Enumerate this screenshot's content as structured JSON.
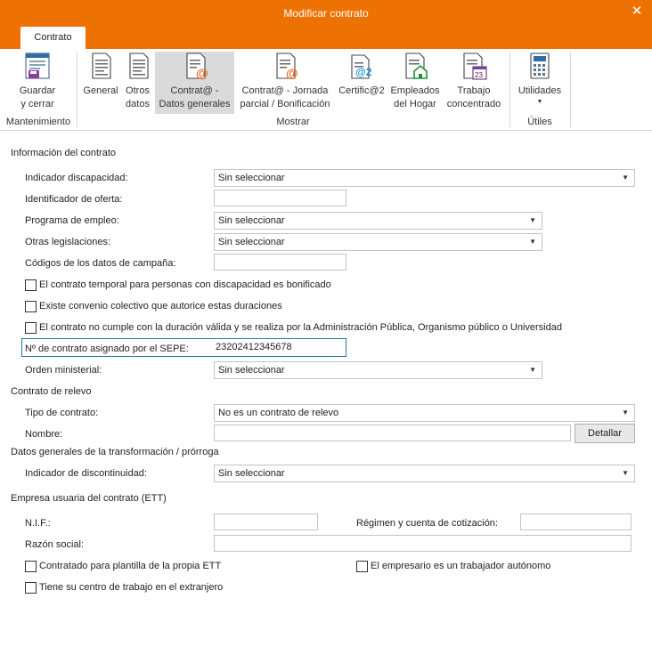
{
  "window": {
    "title": "Modificar contrato"
  },
  "tabs": [
    {
      "label": "Contrato"
    }
  ],
  "ribbon": {
    "mantenimiento": {
      "label": "Mantenimiento",
      "guardar": "Guardar\ny cerrar"
    },
    "mostrar": {
      "label": "Mostrar",
      "items": [
        {
          "label": "General"
        },
        {
          "label": "Otros\ndatos"
        },
        {
          "label": "Contrat@ -\nDatos generales"
        },
        {
          "label": "Contrat@ - Jornada\nparcial / Bonificación"
        },
        {
          "label": "Certific@2"
        },
        {
          "label": "Empleados\ndel Hogar"
        },
        {
          "label": "Trabajo\nconcentrado"
        }
      ]
    },
    "utiles": {
      "label": "Útiles",
      "utilidades": "Utilidades"
    },
    "calendar_day": "23",
    "badge_at": "@",
    "badge_at2": "@2"
  },
  "info": {
    "section": "Información del contrato",
    "discapacidad_label": "Indicador discapacidad:",
    "discapacidad_value": "Sin seleccionar",
    "oferta_label": "Identificador de oferta:",
    "oferta_value": "",
    "programa_label": "Programa de empleo:",
    "programa_value": "Sin seleccionar",
    "legislaciones_label": "Otras legislaciones:",
    "legislaciones_value": "Sin seleccionar",
    "campana_label": "Códigos de los datos de campaña:",
    "campana_value": "",
    "chk1": "El contrato temporal para personas con discapacidad es bonificado",
    "chk2": "Existe convenio colectivo que autorice estas duraciones",
    "chk3": "El contrato no cumple con la duración válida y se realiza por la Administración Pública, Organismo público o Universidad",
    "sepe_label": "Nº de contrato asignado por el SEPE:",
    "sepe_value": "23202412345678",
    "orden_label": "Orden ministerial:",
    "orden_value": "Sin seleccionar"
  },
  "relevo": {
    "section": "Contrato de relevo",
    "tipo_label": "Tipo de contrato:",
    "tipo_value": "No es un contrato de relevo",
    "nombre_label": "Nombre:",
    "nombre_value": "",
    "detallar": "Detallar"
  },
  "transformacion": {
    "section": "Datos generales de la transformación / prórroga",
    "discontinuidad_label": "Indicador de discontinuidad:",
    "discontinuidad_value": "Sin seleccionar"
  },
  "ett": {
    "section": "Empresa usuaria del contrato (ETT)",
    "nif_label": "N.I.F.:",
    "nif_value": "",
    "regimen_label": "Régimen y cuenta de cotización:",
    "regimen_value": "",
    "razon_label": "Razón social:",
    "razon_value": "",
    "chk_plantilla": "Contratado para plantilla de la propia ETT",
    "chk_autonomo": "El empresario es un trabajador autónomo",
    "chk_extranjero": "Tiene su centro de trabajo en el extranjero"
  },
  "colors": {
    "accent": "#ee7203",
    "focus": "#1e7aa3"
  }
}
